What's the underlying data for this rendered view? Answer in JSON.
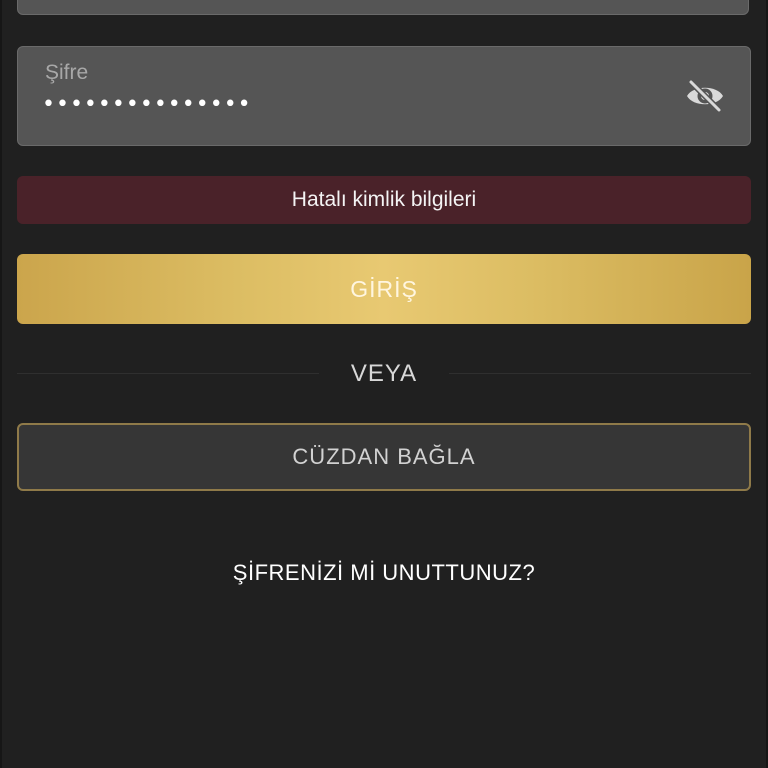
{
  "password_field": {
    "label": "Şifre",
    "value": "•••••••••••••••",
    "visibility_icon": "eye-slash-icon"
  },
  "error": {
    "message": "Hatalı kimlik bilgileri"
  },
  "login_button": {
    "label": "GİRİŞ"
  },
  "divider": {
    "label": "VEYA"
  },
  "wallet_button": {
    "label": "CÜZDAN BAĞLA"
  },
  "forgot_password": {
    "label": "ŞİFRENİZİ Mİ UNUTTUNUZ?"
  },
  "colors": {
    "background": "#202020",
    "input_background": "#555555",
    "error_background": "#4a2229",
    "accent_gold": "#e8c972",
    "wallet_border": "#8f7a49"
  }
}
